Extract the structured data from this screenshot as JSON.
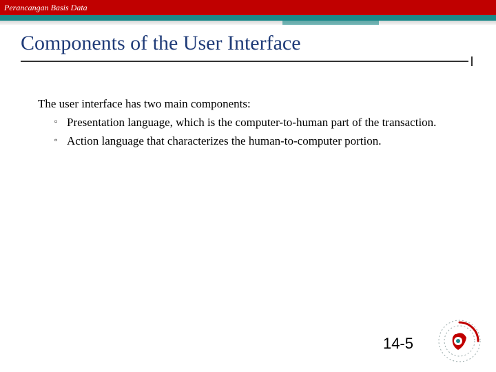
{
  "header": {
    "course": "Perancangan Basis Data"
  },
  "title": "Components of the User Interface",
  "body": {
    "lead": "The user interface has two main components:",
    "bullets": [
      "Presentation language, which is the computer-to-human part of the transaction.",
      "Action language that characterizes the human-to-computer portion."
    ]
  },
  "page_number": "14-5"
}
